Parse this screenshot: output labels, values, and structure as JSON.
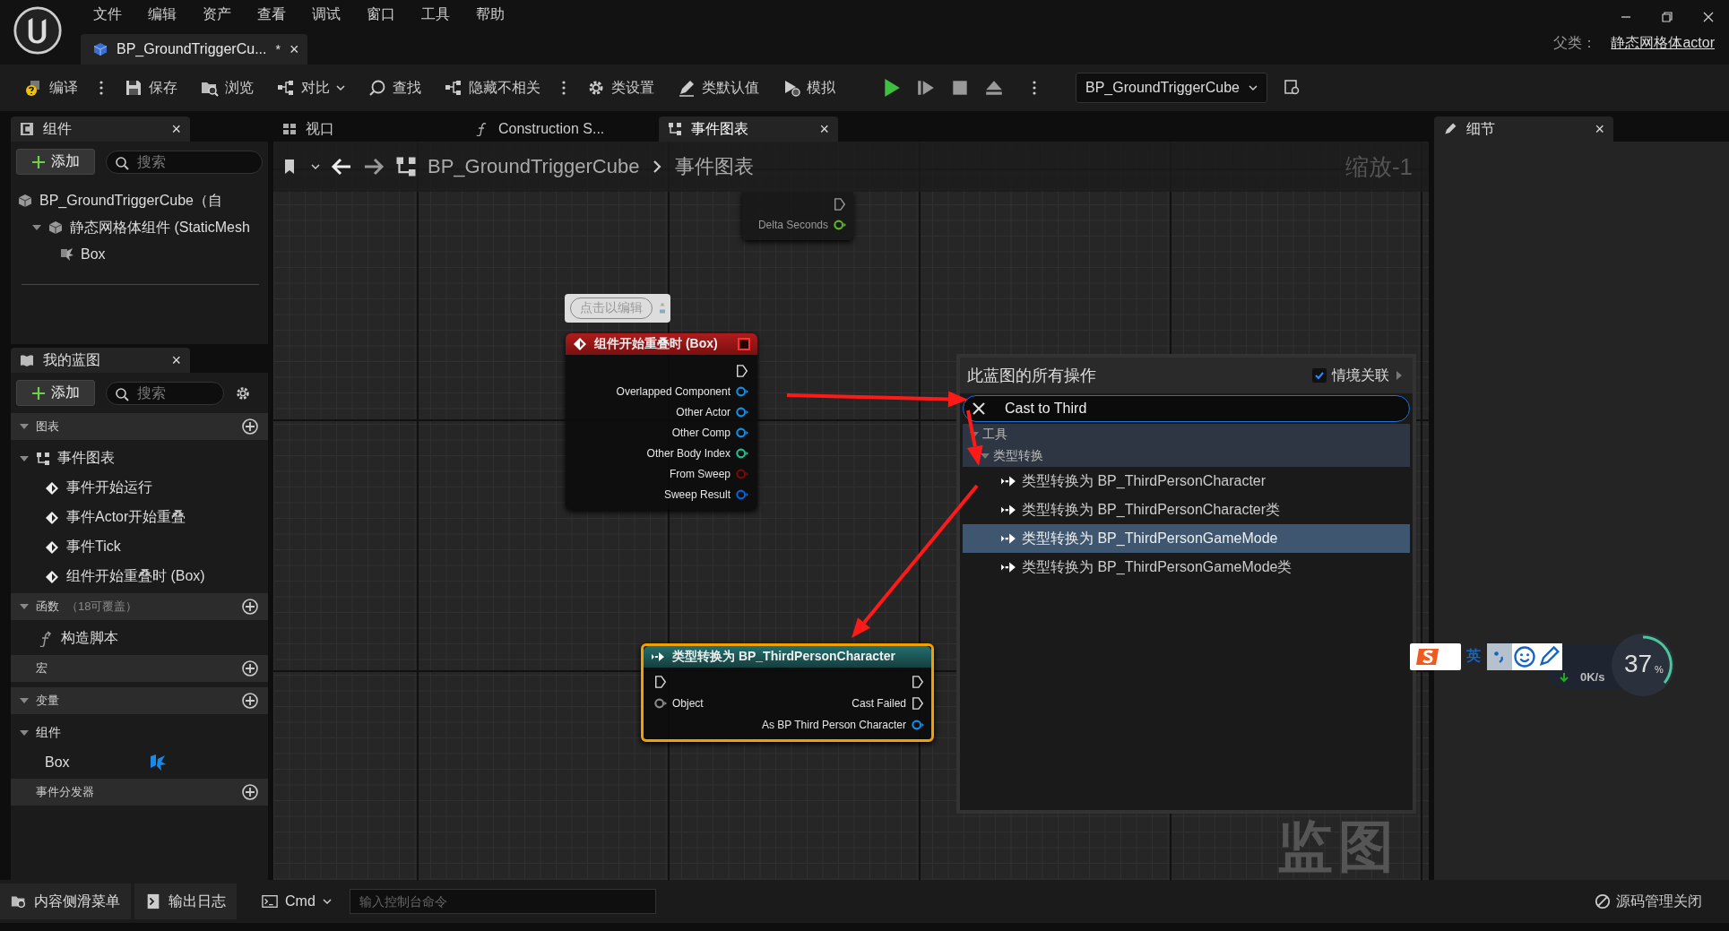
{
  "menu_bar": {
    "items": [
      "文件",
      "编辑",
      "资产",
      "查看",
      "调试",
      "窗口",
      "工具",
      "帮助"
    ]
  },
  "document_tab": {
    "title": "BP_GroundTriggerCu...",
    "modified": "*",
    "close": "×"
  },
  "parent_class": {
    "label": "父类：",
    "value": "静态网格体actor"
  },
  "toolbar": {
    "items": [
      {
        "kind": "button",
        "label": "编译"
      },
      {
        "kind": "more"
      },
      {
        "kind": "button",
        "label": "保存"
      },
      {
        "kind": "button",
        "label": "浏览"
      },
      {
        "kind": "dropdown",
        "label": "对比"
      },
      {
        "kind": "button",
        "label": "查找"
      },
      {
        "kind": "button",
        "label": "隐藏不相关"
      },
      {
        "kind": "more"
      },
      {
        "kind": "button",
        "label": "类设置"
      },
      {
        "kind": "button",
        "label": "类默认值"
      },
      {
        "kind": "button",
        "label": "模拟"
      },
      {
        "kind": "playback"
      },
      {
        "kind": "more"
      },
      {
        "kind": "selector",
        "label": "BP_GroundTriggerCube"
      },
      {
        "kind": "find"
      }
    ]
  },
  "components_panel": {
    "tab": {
      "label": "组件",
      "close": "×"
    },
    "add_button": "添加",
    "search": {
      "placeholder": "搜索"
    },
    "tree": [
      {
        "label": "BP_GroundTriggerCube（自",
        "children": [
          {
            "label": "静态网格体组件 (StaticMesh",
            "expanded": true,
            "children": [
              {
                "label": "Box"
              }
            ]
          }
        ]
      }
    ]
  },
  "my_blueprint_panel": {
    "tab": {
      "label": "我的蓝图",
      "close": "×"
    },
    "add_button": "添加",
    "search": {
      "placeholder": "搜索"
    },
    "sections": [
      {
        "title": "图表",
        "expanded": true,
        "items": [
          {
            "label": "事件图表",
            "kind": "graph",
            "expanded": true,
            "children": [
              {
                "label": "事件开始运行"
              },
              {
                "label": "事件Actor开始重叠"
              },
              {
                "label": "事件Tick"
              },
              {
                "label": "组件开始重叠时 (Box)"
              }
            ]
          }
        ]
      },
      {
        "title": "函数",
        "note": "（18可覆盖）",
        "expanded": true,
        "items": [
          {
            "label": "构造脚本",
            "kind": "function"
          }
        ]
      },
      {
        "title": "宏"
      },
      {
        "title": "变量",
        "expanded": true,
        "items": [
          {
            "label": "组件",
            "kind": "category",
            "expanded": true,
            "children": [
              {
                "label": "Box"
              }
            ]
          }
        ]
      },
      {
        "title": "事件分发器"
      }
    ]
  },
  "graph_tabs": [
    {
      "label": "视口",
      "selected": false
    },
    {
      "label": "Construction S...",
      "selected": false
    },
    {
      "label": "事件图表",
      "selected": true,
      "close": "×"
    }
  ],
  "graph": {
    "breadcrumb": [
      "BP_GroundTriggerCube",
      "事件图表"
    ],
    "zoom_label": "缩放-1",
    "watermark": "监图",
    "comment_bubble": "点击以编辑",
    "nodes": [
      {
        "kind": "tick",
        "outputs": [
          {
            "kind": "exec"
          },
          {
            "kind": "data",
            "label": "Delta Seconds",
            "color": "#5fb52a"
          }
        ]
      },
      {
        "kind": "event",
        "title": "组件开始重叠时 (Box)",
        "outputs": [
          {
            "kind": "exec"
          },
          {
            "kind": "data",
            "label": "Overlapped Component",
            "color": "#0f8fe6"
          },
          {
            "kind": "data",
            "label": "Other Actor",
            "color": "#0f8fe6"
          },
          {
            "kind": "data",
            "label": "Other Comp",
            "color": "#0f8fe6"
          },
          {
            "kind": "data",
            "label": "Other Body Index",
            "color": "#1fc090"
          },
          {
            "kind": "data",
            "label": "From Sweep",
            "color": "#7a0a0a"
          },
          {
            "kind": "data",
            "label": "Sweep Result",
            "color": "#0a60d8"
          }
        ]
      },
      {
        "kind": "cast",
        "title": "类型转换为 BP_ThirdPersonCharacter",
        "selected": true,
        "inputs": [
          {
            "kind": "exec"
          },
          {
            "kind": "data",
            "label": "Object",
            "color": "#8a8a8a"
          }
        ],
        "outputs": [
          {
            "kind": "exec"
          },
          {
            "kind": "exec",
            "label": "Cast Failed"
          },
          {
            "kind": "data",
            "label": "As BP Third Person Character",
            "color": "#0f8fe6"
          }
        ]
      }
    ],
    "context_menu": {
      "title": "此蓝图的所有操作",
      "context_sensitive": {
        "label": "情境关联",
        "checked": true
      },
      "search": {
        "value": "Cast to Third"
      },
      "tree": [
        {
          "label": "工具",
          "expanded": true,
          "children": [
            {
              "label": "类型转换",
              "expanded": true,
              "children": [
                {
                  "label": "类型转换为 BP_ThirdPersonCharacter",
                  "selected": false
                },
                {
                  "label": "类型转换为 BP_ThirdPersonCharacter类",
                  "selected": false
                },
                {
                  "label": "类型转换为 BP_ThirdPersonGameMode",
                  "selected": true
                },
                {
                  "label": "类型转换为 BP_ThirdPersonGameMode类",
                  "selected": false
                }
              ]
            }
          ]
        }
      ]
    }
  },
  "details_panel": {
    "tab": {
      "label": "细节",
      "close": "×"
    }
  },
  "bottom_bar": {
    "items": [
      {
        "kind": "button",
        "label": "内容侧滑菜单"
      },
      {
        "kind": "button",
        "label": "输出日志"
      },
      {
        "kind": "dropdown",
        "label": "Cmd"
      },
      {
        "kind": "input",
        "placeholder": "输入控制台命令"
      }
    ],
    "source_control": "源码管理关闭"
  },
  "ime_toolbar": {
    "language": "英",
    "net_speed": "0K/s",
    "cpu": "37",
    "cpu_unit": "%"
  }
}
